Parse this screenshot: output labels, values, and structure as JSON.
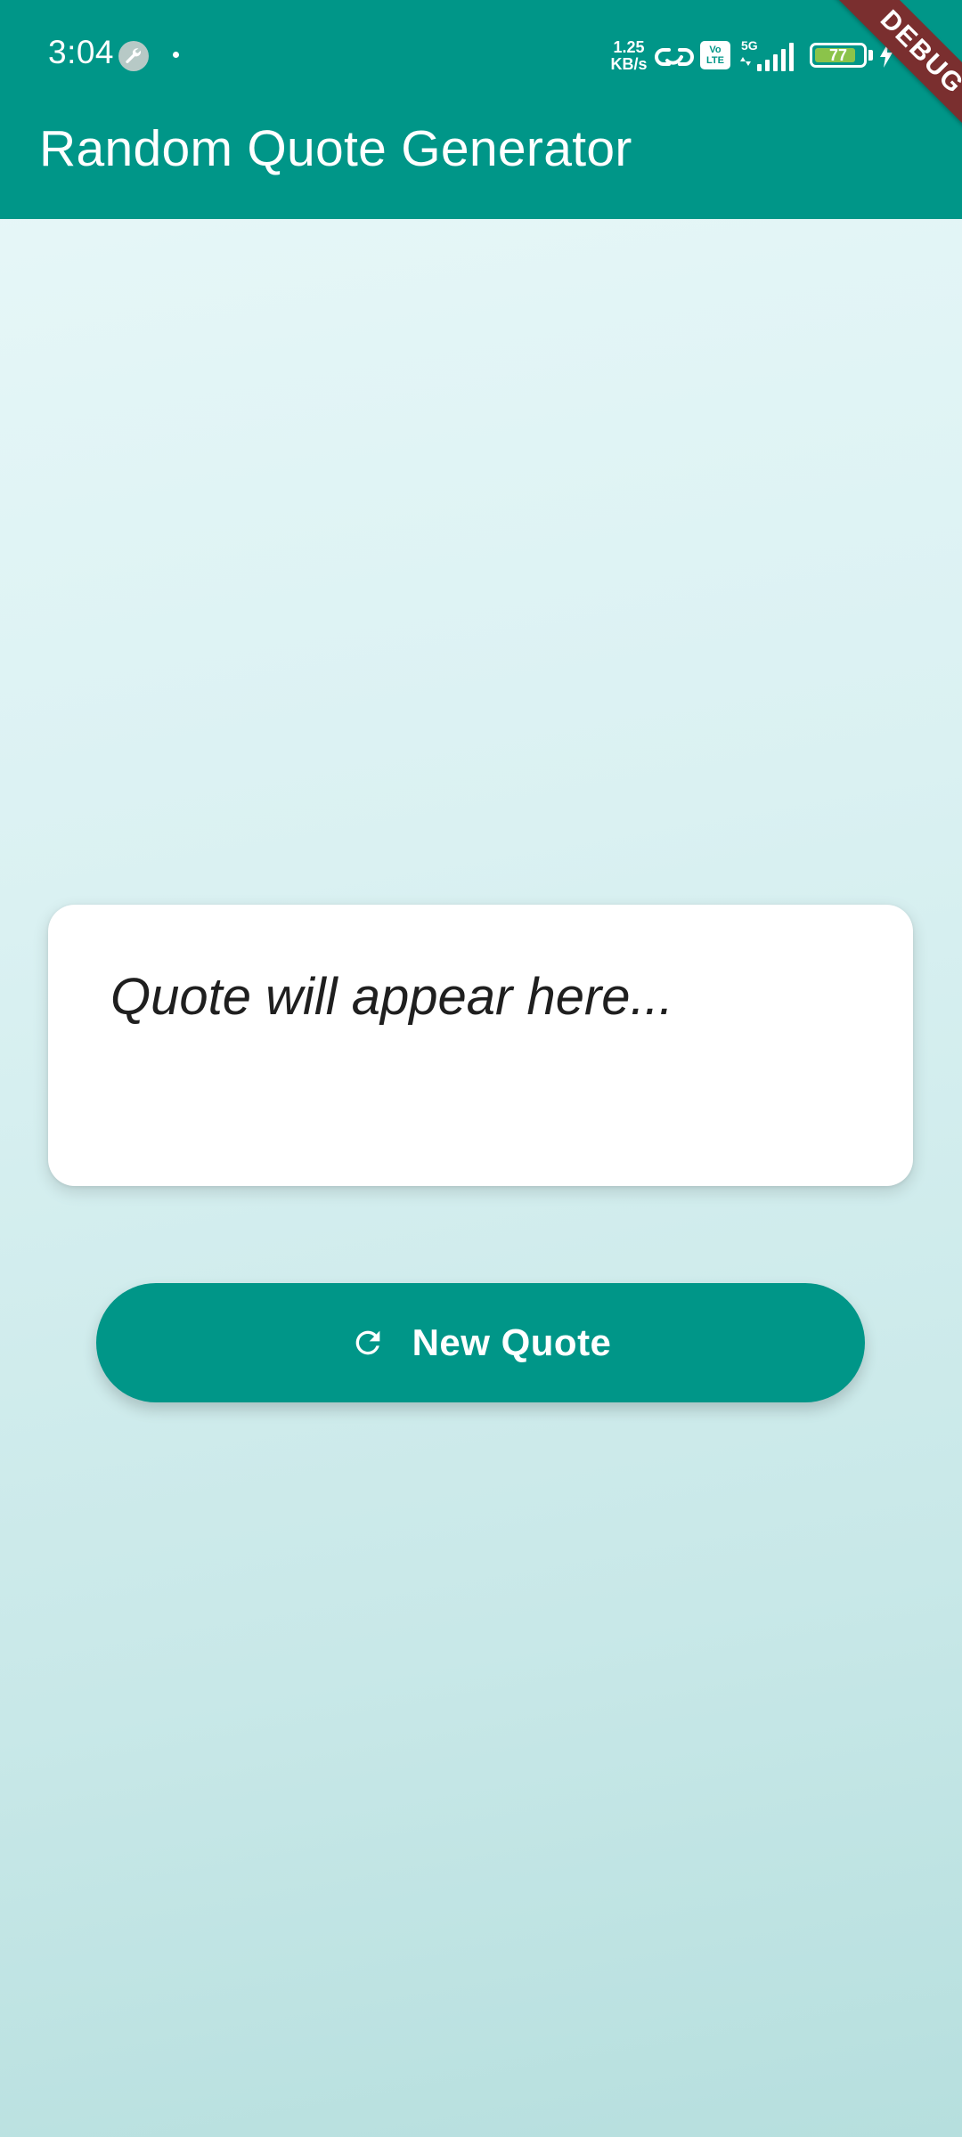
{
  "status_bar": {
    "time": "3:04",
    "net_speed_value": "1.25",
    "net_speed_unit": "KB/s",
    "volte_top": "Vo",
    "volte_bottom": "LTE",
    "network_type": "5G",
    "battery_level": "77",
    "battery_fraction": 0.77,
    "icons": [
      "wrench-icon",
      "dot-icon",
      "link-icon",
      "volte-icon",
      "signal-icon",
      "battery-icon",
      "charge-icon"
    ]
  },
  "app_bar": {
    "title": "Random Quote Generator"
  },
  "debug_banner": {
    "label": "DEBUG"
  },
  "quote_card": {
    "text": "Quote will appear here..."
  },
  "new_quote_button": {
    "icon": "refresh-icon",
    "label": "New Quote"
  },
  "colors": {
    "primary": "#009688",
    "debug_banner": "#7a2f2f",
    "battery_fill": "#8bc34a"
  }
}
